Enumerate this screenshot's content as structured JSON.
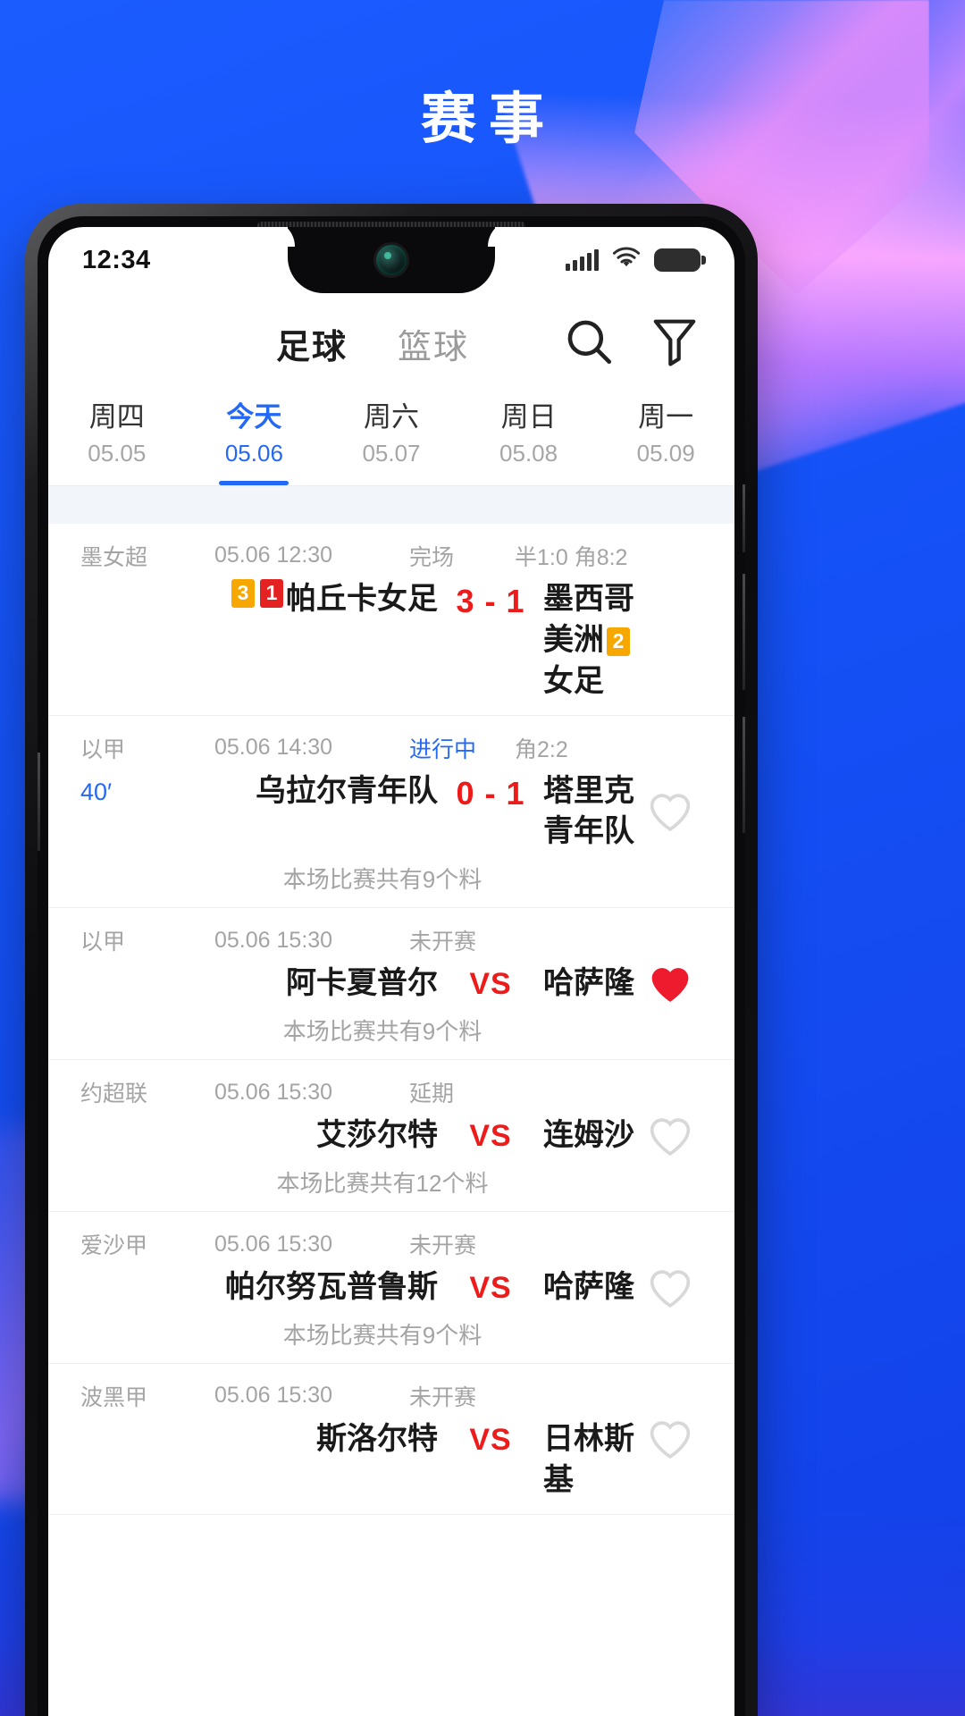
{
  "page": {
    "title": "赛事"
  },
  "status_bar": {
    "time": "12:34",
    "signal_icon": "signal-bars-icon",
    "wifi_icon": "wifi-icon",
    "battery_icon": "battery-icon"
  },
  "nav": {
    "sport_tabs": [
      {
        "label": "足球",
        "active": true
      },
      {
        "label": "篮球",
        "active": false
      }
    ],
    "search_icon": "search-icon",
    "filter_icon": "filter-funnel-icon"
  },
  "date_tabs": [
    {
      "dow": "周四",
      "date": "05.05",
      "active": false
    },
    {
      "dow": "今天",
      "date": "05.06",
      "active": true
    },
    {
      "dow": "周六",
      "date": "05.07",
      "active": false
    },
    {
      "dow": "周日",
      "date": "05.08",
      "active": false
    },
    {
      "dow": "周一",
      "date": "05.09",
      "active": false
    }
  ],
  "colors": {
    "accent_blue": "#2468F6",
    "score_red": "#ee1b1b",
    "yellow_card": "#f6a800",
    "red_card": "#e52222",
    "favorite_filled": "#ee1b2e",
    "muted_text": "#a4a4a4",
    "background_blue": "#1659FF"
  },
  "matches": [
    {
      "league": "墨女超",
      "time": "05.06 12:30",
      "status": "完场",
      "status_live": false,
      "extra": "半1:0 角8:2",
      "minute": "",
      "home_badges": [
        {
          "text": "3",
          "type": "yellow"
        },
        {
          "text": "1",
          "type": "red"
        }
      ],
      "home": "帕丘卡女足",
      "score": "3 - 1",
      "is_vs": false,
      "away": "墨西哥美洲",
      "away_badges": [
        {
          "text": "2",
          "type": "yellow"
        }
      ],
      "away_line2": "女足",
      "note": "",
      "favorite": "none"
    },
    {
      "league": "以甲",
      "time": "05.06 14:30",
      "status": "进行中",
      "status_live": true,
      "extra": "角2:2",
      "minute": "40′",
      "home_badges": [],
      "home": "乌拉尔青年队",
      "score": "0 - 1",
      "is_vs": false,
      "away": "塔里克青年队",
      "away_badges": [],
      "away_line2": "",
      "note": "本场比赛共有9个料",
      "favorite": "outline"
    },
    {
      "league": "以甲",
      "time": "05.06 15:30",
      "status": "未开赛",
      "status_live": false,
      "extra": "",
      "minute": "",
      "home_badges": [],
      "home": "阿卡夏普尔",
      "score": "VS",
      "is_vs": true,
      "away": "哈萨隆",
      "away_badges": [],
      "away_line2": "",
      "note": "本场比赛共有9个料",
      "favorite": "filled"
    },
    {
      "league": "约超联",
      "time": "05.06 15:30",
      "status": "延期",
      "status_live": false,
      "extra": "",
      "minute": "",
      "home_badges": [],
      "home": "艾莎尔特",
      "score": "VS",
      "is_vs": true,
      "away": "连姆沙",
      "away_badges": [],
      "away_line2": "",
      "note": "本场比赛共有12个料",
      "favorite": "outline"
    },
    {
      "league": "爱沙甲",
      "time": "05.06 15:30",
      "status": "未开赛",
      "status_live": false,
      "extra": "",
      "minute": "",
      "home_badges": [],
      "home": "帕尔努瓦普鲁斯",
      "score": "VS",
      "is_vs": true,
      "away": "哈萨隆",
      "away_badges": [],
      "away_line2": "",
      "note": "本场比赛共有9个料",
      "favorite": "outline"
    },
    {
      "league": "波黑甲",
      "time": "05.06 15:30",
      "status": "未开赛",
      "status_live": false,
      "extra": "",
      "minute": "",
      "home_badges": [],
      "home": "斯洛尔特",
      "score": "VS",
      "is_vs": true,
      "away": "日林斯基",
      "away_badges": [],
      "away_line2": "",
      "note": "",
      "favorite": "outline"
    }
  ]
}
